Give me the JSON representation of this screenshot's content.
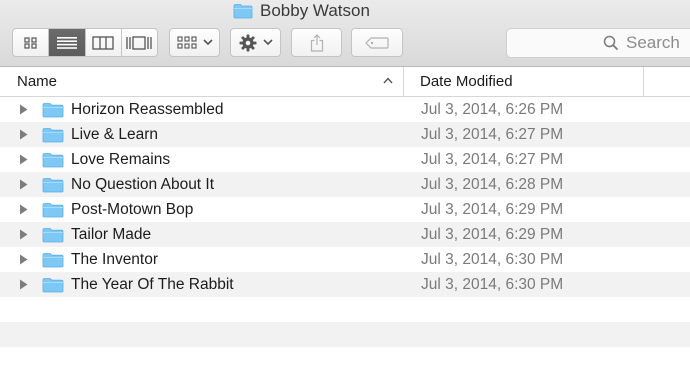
{
  "window": {
    "title": "Bobby Watson",
    "title_icon": "folder-icon"
  },
  "toolbar": {
    "view_buttons": [
      {
        "name": "icon-view",
        "icon": "grid-icon",
        "active": false
      },
      {
        "name": "list-view",
        "icon": "list-icon",
        "active": true
      },
      {
        "name": "column-view",
        "icon": "columns-icon",
        "active": false
      },
      {
        "name": "cover-flow-view",
        "icon": "coverflow-icon",
        "active": false
      }
    ],
    "arrange_icon": "arrange-grid-icon",
    "action_icon": "gear-icon",
    "share_icon": "share-icon",
    "tag_icon": "tag-icon",
    "search": {
      "placeholder": "Search",
      "icon": "search-icon"
    }
  },
  "columns": {
    "name": "Name",
    "date": "Date Modified",
    "sort": "ascending"
  },
  "files": [
    {
      "name": "Horizon Reassembled",
      "date": "Jul 3, 2014, 6:26 PM"
    },
    {
      "name": "Live & Learn",
      "date": "Jul 3, 2014, 6:27 PM"
    },
    {
      "name": "Love Remains",
      "date": "Jul 3, 2014, 6:27 PM"
    },
    {
      "name": "No Question About It",
      "date": "Jul 3, 2014, 6:28 PM"
    },
    {
      "name": "Post-Motown Bop",
      "date": "Jul 3, 2014, 6:29 PM"
    },
    {
      "name": "Tailor Made",
      "date": "Jul 3, 2014, 6:29 PM"
    },
    {
      "name": "The Inventor",
      "date": "Jul 3, 2014, 6:30 PM"
    },
    {
      "name": "The Year Of The Rabbit",
      "date": "Jul 3, 2014, 6:30 PM"
    }
  ],
  "colors": {
    "folder": "#7ec8f5",
    "active_segment": "#606060",
    "row_alt": "#f2f2f2"
  }
}
